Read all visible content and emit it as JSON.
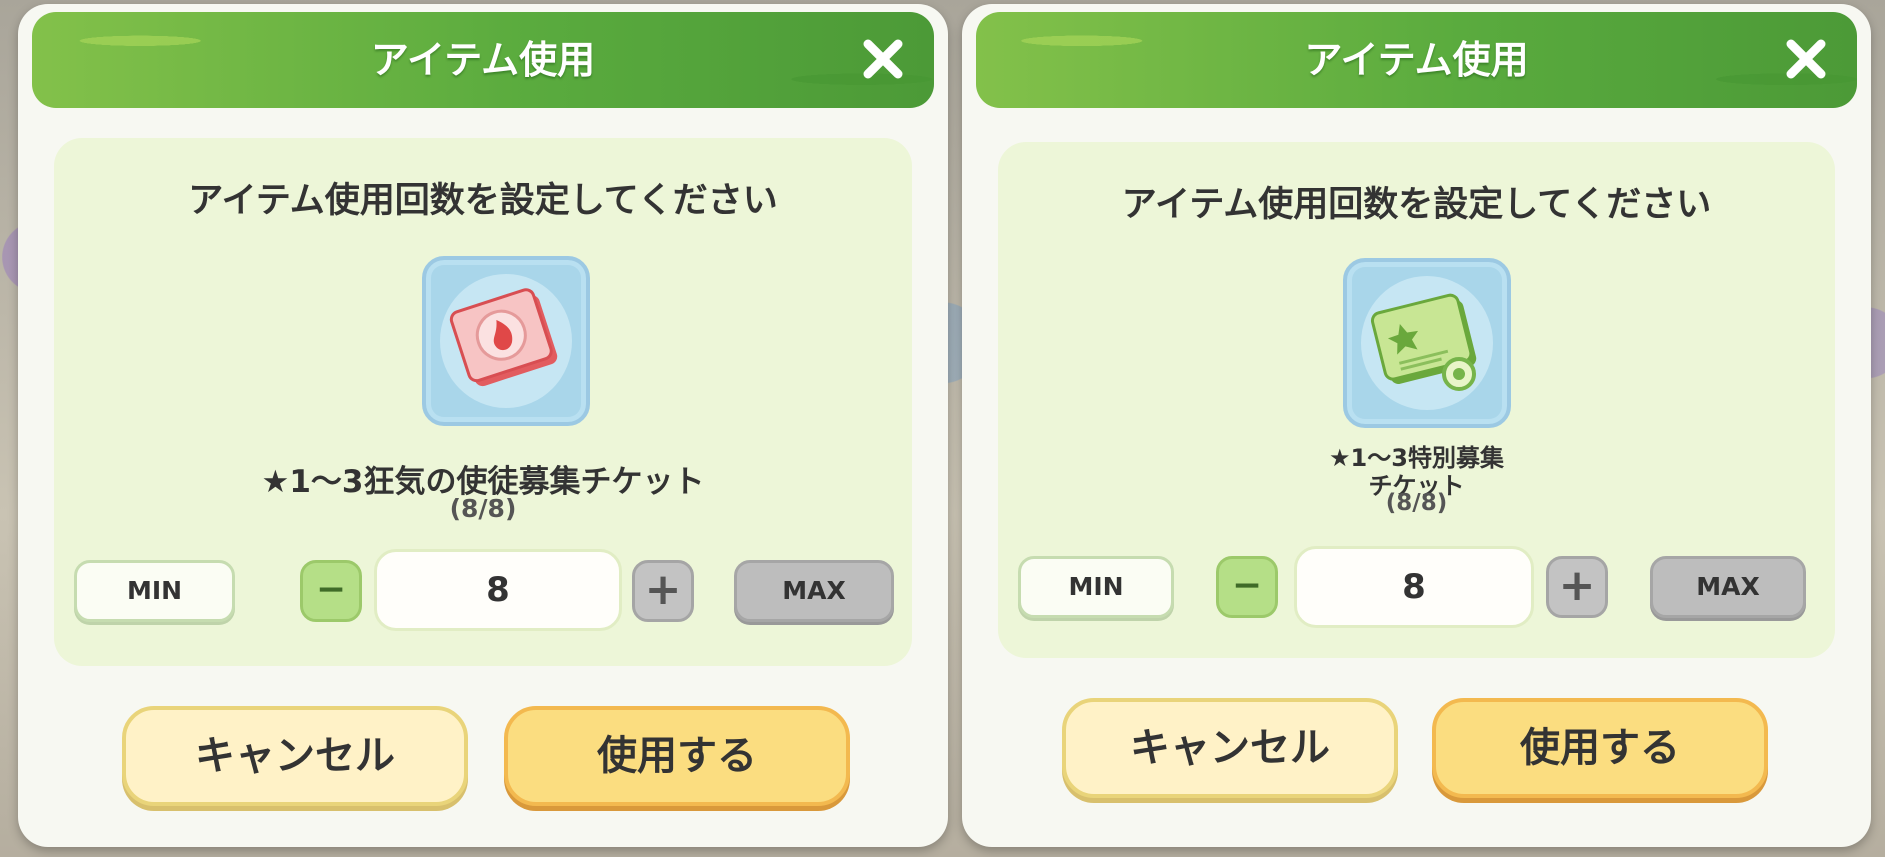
{
  "dialogs": [
    {
      "title": "アイテム使用",
      "prompt": "アイテム使用回数を設定してください",
      "item_name_line1": "★1～3狂気の使徒募集チケット",
      "item_name_line2": "",
      "count": "(8/8)",
      "min_label": "MIN",
      "max_label": "MAX",
      "minus_symbol": "−",
      "plus_symbol": "+",
      "quantity": "8",
      "cancel_label": "キャンセル",
      "use_label": "使用する",
      "icon": "red-ticket-icon"
    },
    {
      "title": "アイテム使用",
      "prompt": "アイテム使用回数を設定してください",
      "item_name_line1": "★1～3特別募集",
      "item_name_line2": "チケット",
      "count": "(8/8)",
      "min_label": "MIN",
      "max_label": "MAX",
      "minus_symbol": "−",
      "plus_symbol": "+",
      "quantity": "8",
      "cancel_label": "キャンセル",
      "use_label": "使用する",
      "icon": "green-ticket-icon"
    }
  ],
  "colors": {
    "title_bar": "#5aab3e",
    "panel": "#edf6d8",
    "use_button": "#fbdd80",
    "cancel_button": "#fff2c7"
  }
}
